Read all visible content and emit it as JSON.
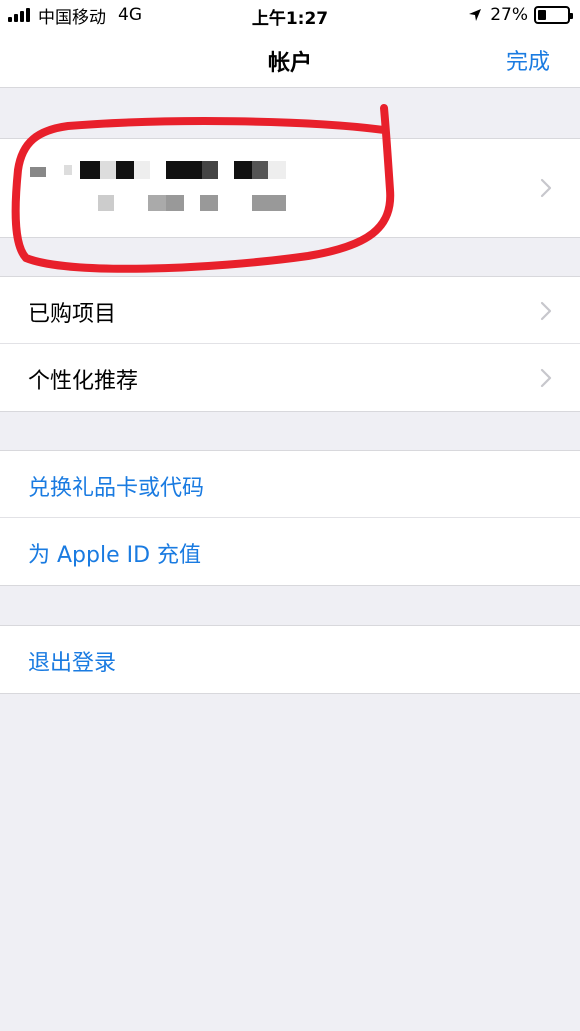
{
  "status_bar": {
    "carrier": "中国移动",
    "network": "4G",
    "time": "上午1:27",
    "battery": "27%",
    "battery_level": 0.27
  },
  "nav": {
    "title": "帐户",
    "done": "完成"
  },
  "sections": {
    "purchases": "已购项目",
    "recommendations": "个性化推荐",
    "redeem": "兑换礼品卡或代码",
    "add_funds": "为 Apple ID 充值",
    "sign_out": "退出登录"
  },
  "colors": {
    "accent": "#1A7BE1",
    "annotation": "#E8202B",
    "background": "#EFEFF4"
  },
  "icons": [
    "signal-icon",
    "location-arrow-icon",
    "battery-icon",
    "chevron-right-icon"
  ]
}
